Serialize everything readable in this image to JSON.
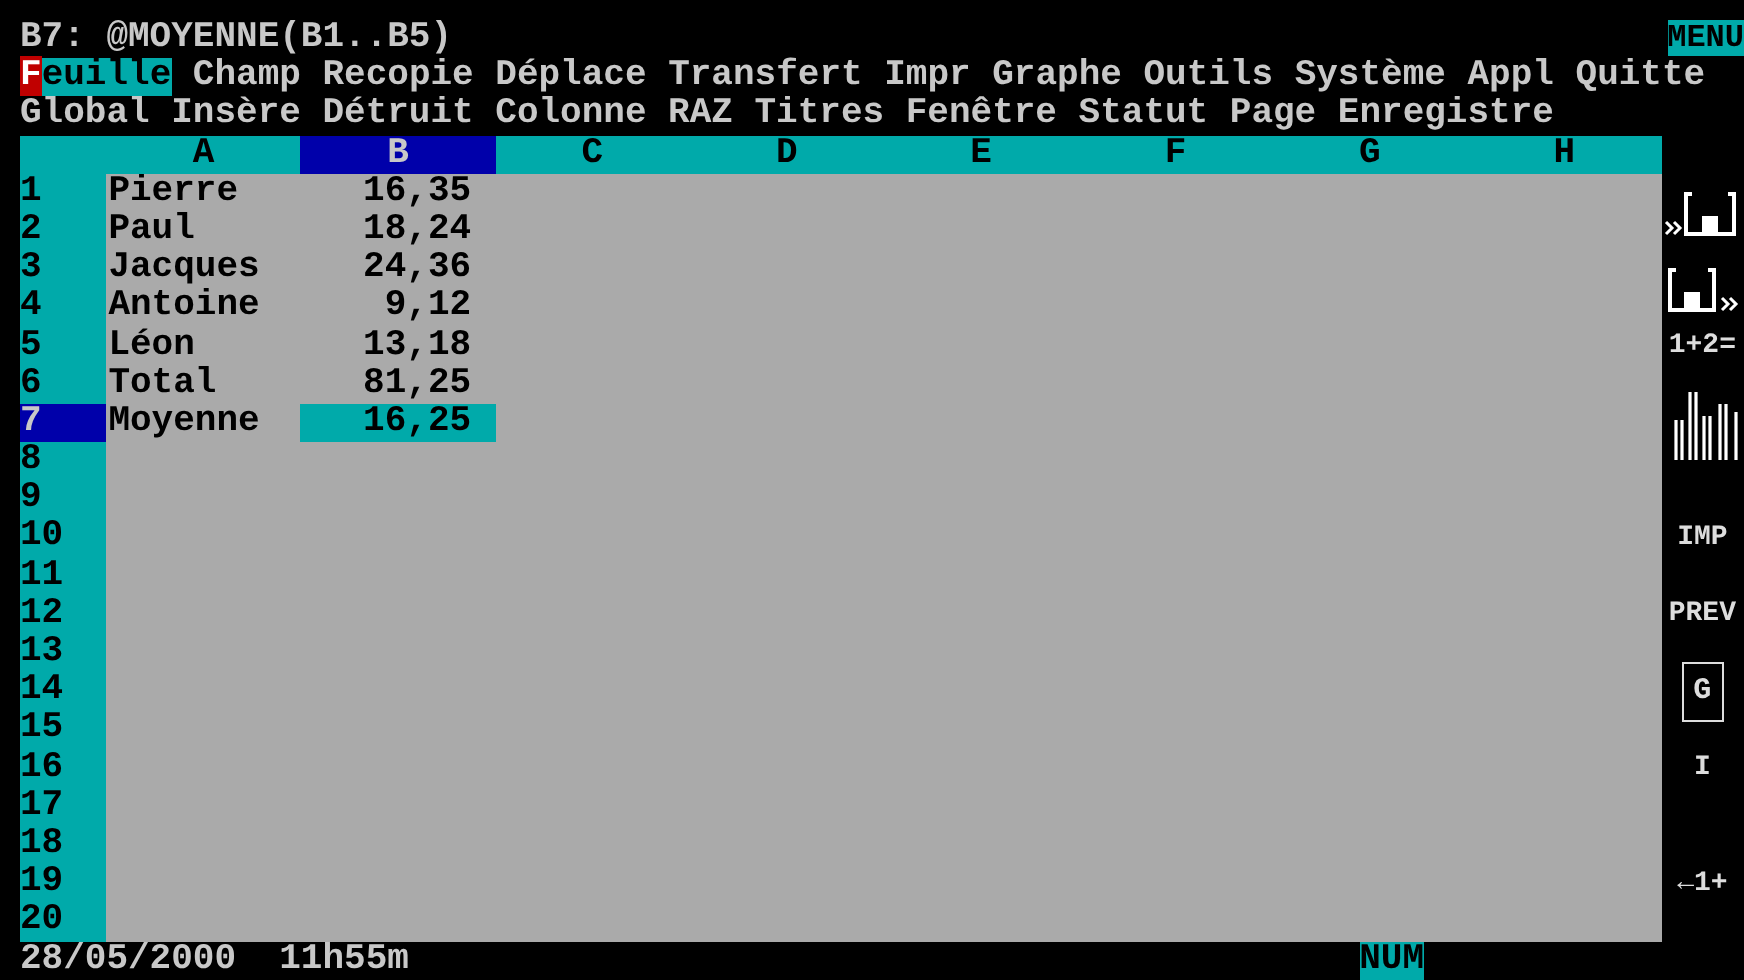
{
  "control_line": {
    "cell_contents": "B7: @MOYENNE(B1..B5)",
    "mode": "MENU"
  },
  "menu": [
    {
      "label": "Feuille",
      "selected": true
    },
    {
      "label": "Champ",
      "selected": false
    },
    {
      "label": "Recopie",
      "selected": false
    },
    {
      "label": "Déplace",
      "selected": false
    },
    {
      "label": "Transfert",
      "selected": false
    },
    {
      "label": "Impr",
      "selected": false
    },
    {
      "label": "Graphe",
      "selected": false
    },
    {
      "label": "Outils",
      "selected": false
    },
    {
      "label": "Système",
      "selected": false
    },
    {
      "label": "Appl",
      "selected": false
    },
    {
      "label": "Quitte",
      "selected": false
    }
  ],
  "submenu_prompt": "Global Insère Détruit Colonne RAZ Titres Fenêtre Statut Page Enregistre",
  "columns": [
    {
      "label": "A",
      "selected": false
    },
    {
      "label": "B",
      "selected": true
    },
    {
      "label": "C",
      "selected": false
    },
    {
      "label": "D",
      "selected": false
    },
    {
      "label": "E",
      "selected": false
    },
    {
      "label": "F",
      "selected": false
    },
    {
      "label": "G",
      "selected": false
    },
    {
      "label": "H",
      "selected": false
    }
  ],
  "rows": [
    {
      "label": "1",
      "selected": false,
      "cells": [
        "Pierre",
        "16,35"
      ]
    },
    {
      "label": "2",
      "selected": false,
      "cells": [
        "Paul",
        "18,24"
      ]
    },
    {
      "label": "3",
      "selected": false,
      "cells": [
        "Jacques",
        "24,36"
      ]
    },
    {
      "label": "4",
      "selected": false,
      "cells": [
        "Antoine",
        "9,12"
      ]
    },
    {
      "label": "5",
      "selected": false,
      "cells": [
        "Léon",
        "13,18"
      ]
    },
    {
      "label": "6",
      "selected": false,
      "cells": [
        "Total",
        "81,25"
      ]
    },
    {
      "label": "7",
      "selected": true,
      "cells": [
        "Moyenne",
        "16,25"
      ]
    },
    {
      "label": "8",
      "selected": false
    },
    {
      "label": "9",
      "selected": false
    },
    {
      "label": "10",
      "selected": false
    },
    {
      "label": "11",
      "selected": false
    },
    {
      "label": "12",
      "selected": false
    },
    {
      "label": "13",
      "selected": false
    },
    {
      "label": "14",
      "selected": false
    },
    {
      "label": "15",
      "selected": false
    },
    {
      "label": "16",
      "selected": false
    },
    {
      "label": "17",
      "selected": false
    },
    {
      "label": "18",
      "selected": false
    },
    {
      "label": "19",
      "selected": false
    },
    {
      "label": "20",
      "selected": false
    }
  ],
  "smarticons": [
    {
      "kind": "moveright"
    },
    {
      "kind": "moveleft"
    },
    {
      "kind": "text",
      "label": "1+2="
    },
    {
      "kind": "chart"
    },
    {
      "kind": "text",
      "label": "IMP"
    },
    {
      "kind": "text",
      "label": "PREV"
    },
    {
      "kind": "boxed",
      "label": "G"
    },
    {
      "kind": "text",
      "label": "I"
    },
    {
      "kind": "text",
      "label": "←1+"
    }
  ],
  "status_bar": {
    "date": "28/05/2000",
    "time": "11h55m",
    "indicator": "NUM"
  }
}
